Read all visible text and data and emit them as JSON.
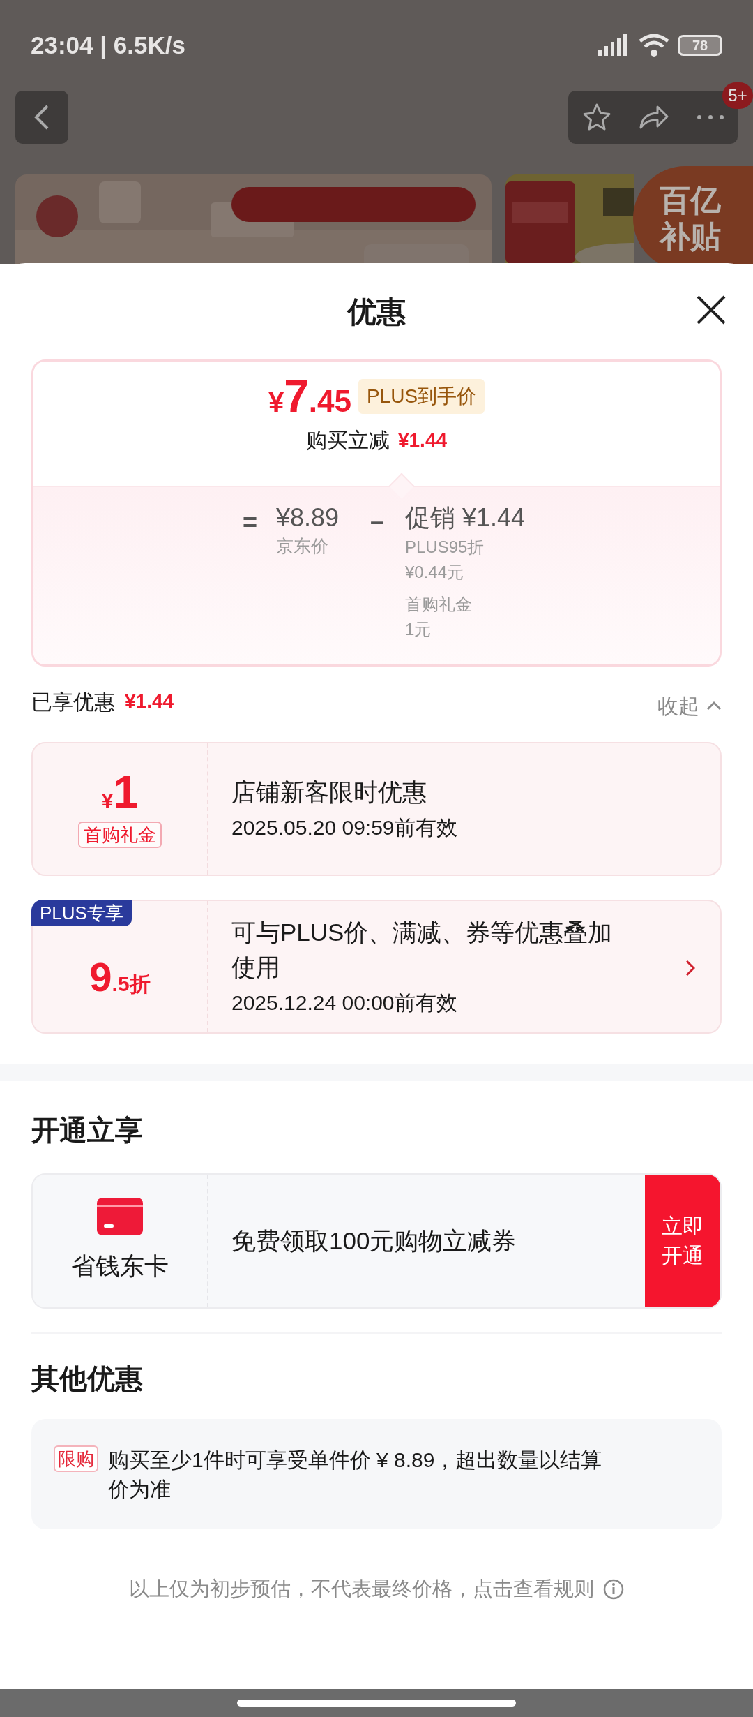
{
  "status_bar": {
    "time": "23:04 | 6.5K/s",
    "battery": "78"
  },
  "nav": {
    "badge": "5+"
  },
  "banner": {
    "badge_lines": [
      "百亿",
      "补贴"
    ]
  },
  "sheet": {
    "title": "优惠"
  },
  "price_summary": {
    "currency": "¥",
    "integer": "7",
    "decimal": ".45",
    "tag": "PLUS到手价",
    "reduce_label": "购买立减",
    "reduce_amount": "¥1.44",
    "equals": "=",
    "base_amount": "¥8.89",
    "base_label": "京东价",
    "minus": "–",
    "promo_title": "促销 ¥1.44",
    "promo_items": [
      {
        "name": "PLUS95折",
        "value": "¥0.44元"
      },
      {
        "name": "首购礼金",
        "value": "1元"
      }
    ]
  },
  "saved": {
    "label": "已享优惠",
    "amount": "¥1.44",
    "collapse": "收起"
  },
  "coupons": [
    {
      "kind": "cash",
      "currency": "¥",
      "amount": "1",
      "tag": "首购礼金",
      "title": "店铺新客限时优惠",
      "validity": "2025.05.20 09:59前有效"
    },
    {
      "kind": "discount",
      "badge": "PLUS专享",
      "amount": "9",
      "suffix": ".5折",
      "title": "可与PLUS价、满减、券等优惠叠加使用",
      "validity": "2025.12.24 00:00前有效"
    }
  ],
  "membership": {
    "heading": "开通立享",
    "name": "省钱东卡",
    "offer": "免费领取100元购物立减券",
    "button": "立即开通"
  },
  "other": {
    "heading": "其他优惠",
    "items": [
      {
        "tag": "限购",
        "text": "购买至少1件时可享受单件价 ¥ 8.89，超出数量以结算价为准"
      }
    ]
  },
  "footer": "以上仅为初步预估，不代表最终价格，点击查看规则"
}
